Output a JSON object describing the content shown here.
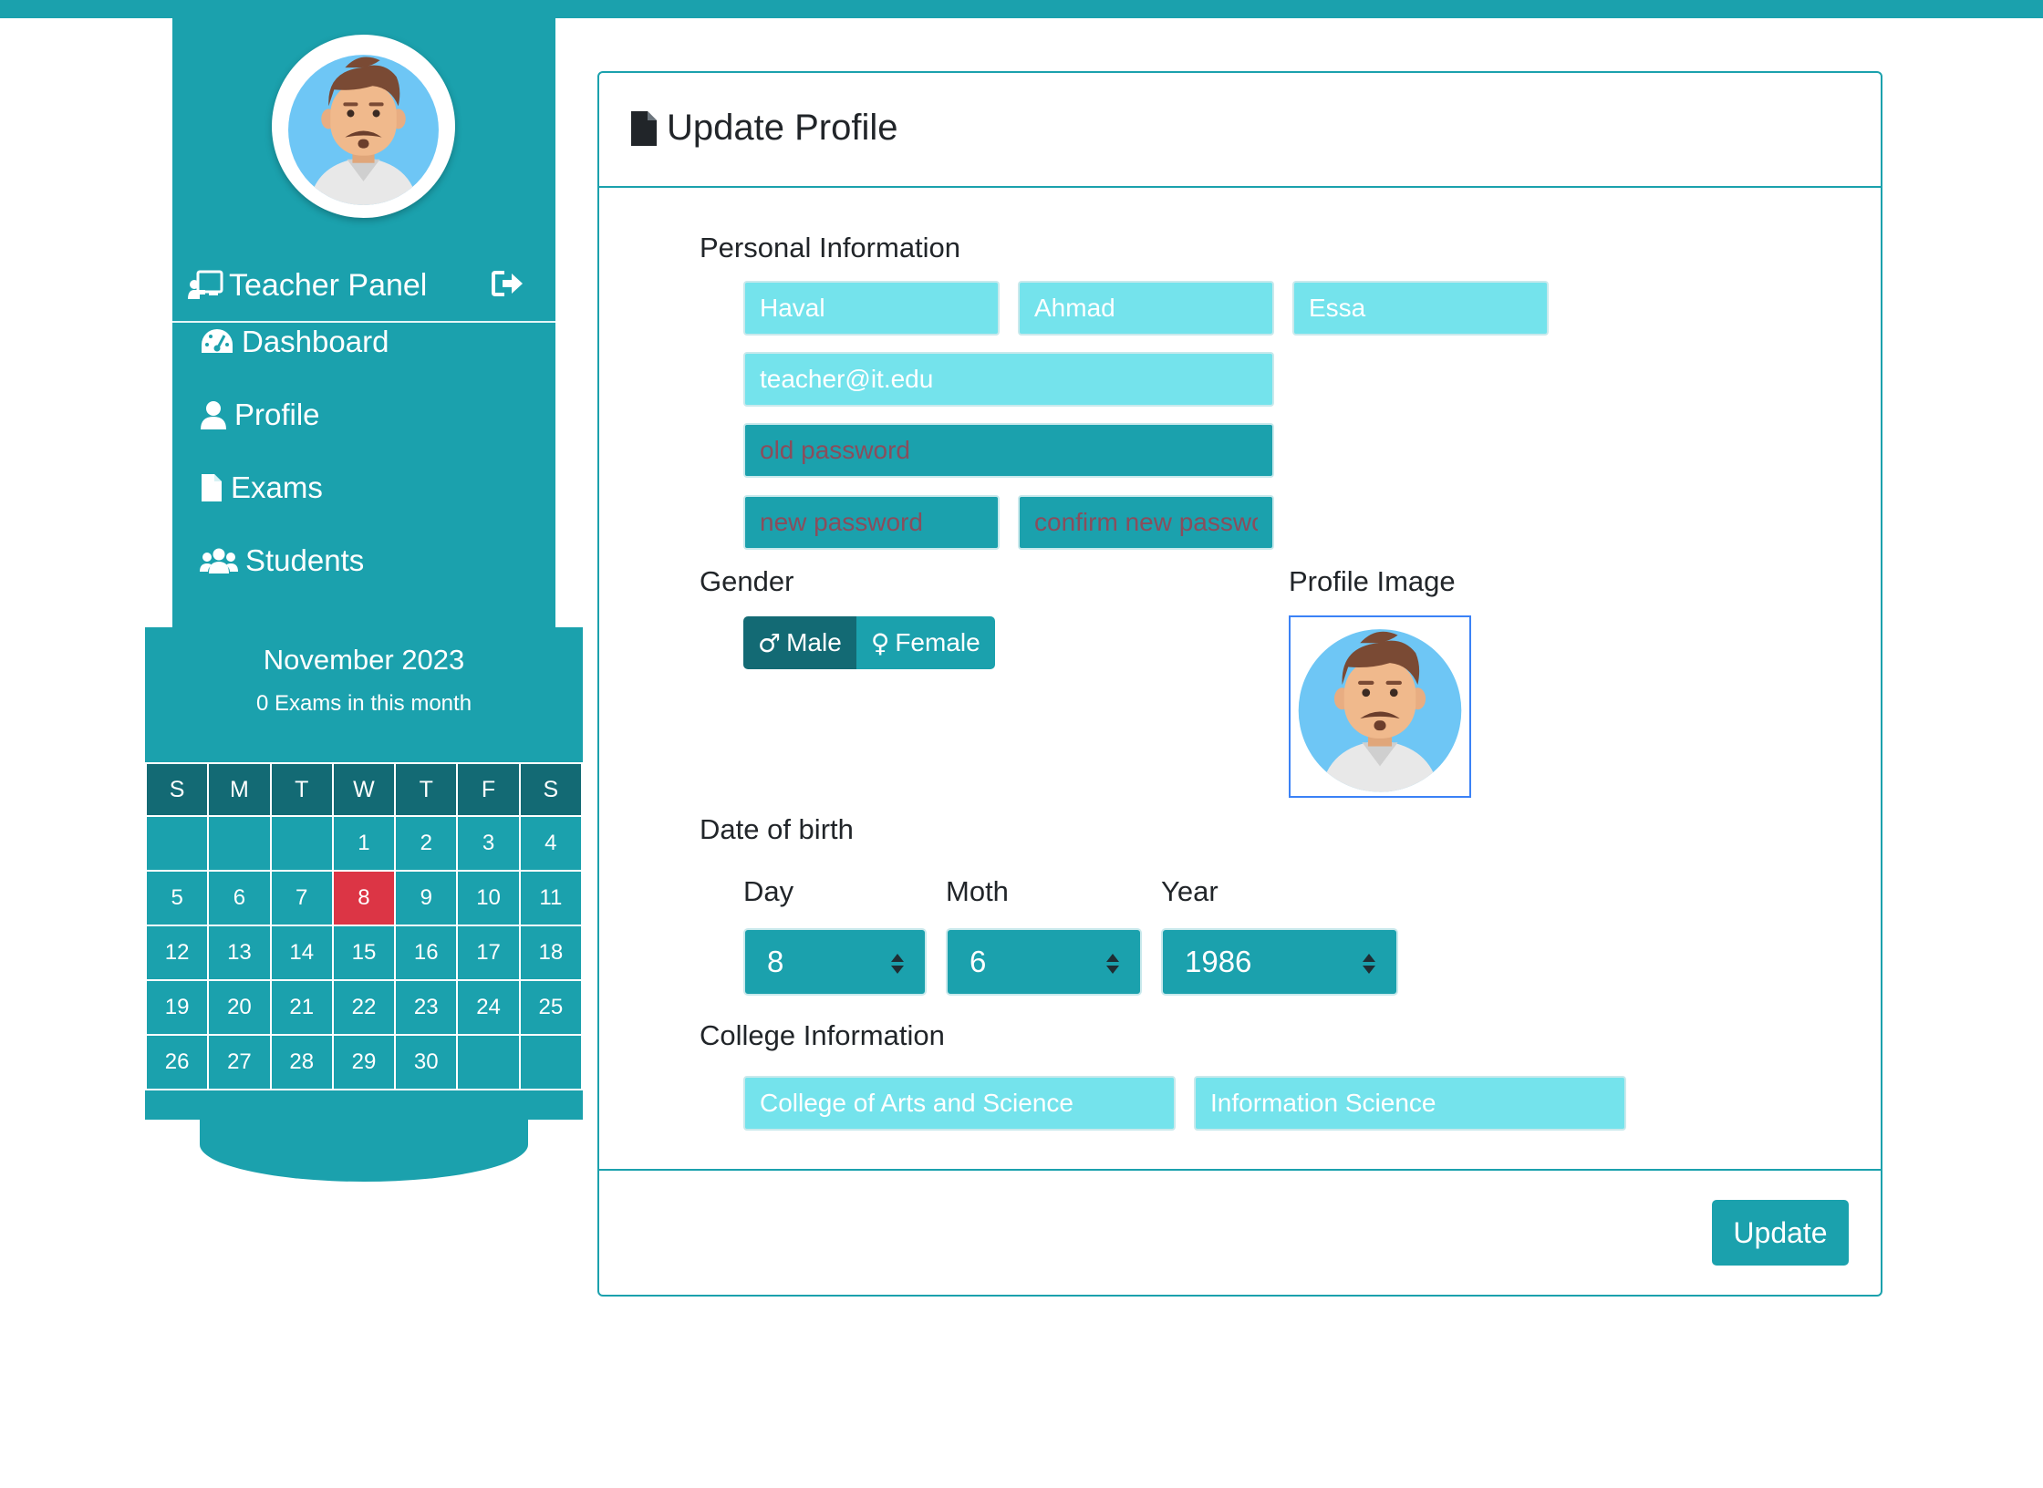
{
  "colors": {
    "primary": "#1ba1ad",
    "primary_dark": "#136a74",
    "field_light": "#74e3ec",
    "today": "#dc3545"
  },
  "sidebar": {
    "panel_title": "Teacher Panel",
    "nav": [
      {
        "label": "Dashboard",
        "icon": "dashboard-icon"
      },
      {
        "label": "Profile",
        "icon": "user-icon"
      },
      {
        "label": "Exams",
        "icon": "file-icon"
      },
      {
        "label": "Students",
        "icon": "users-icon"
      }
    ]
  },
  "calendar": {
    "month": "November 2023",
    "subtitle": "0 Exams in this month",
    "weekdays": [
      "S",
      "M",
      "T",
      "W",
      "T",
      "F",
      "S"
    ],
    "weeks": [
      [
        "",
        "",
        "",
        "1",
        "2",
        "3",
        "4"
      ],
      [
        "5",
        "6",
        "7",
        "8",
        "9",
        "10",
        "11"
      ],
      [
        "12",
        "13",
        "14",
        "15",
        "16",
        "17",
        "18"
      ],
      [
        "19",
        "20",
        "21",
        "22",
        "23",
        "24",
        "25"
      ],
      [
        "26",
        "27",
        "28",
        "29",
        "30",
        "",
        ""
      ]
    ],
    "today": "8"
  },
  "card": {
    "title": "Update Profile",
    "personal_label": "Personal Information",
    "first_name": "Haval",
    "middle_name": "Ahmad",
    "last_name": "Essa",
    "email": "teacher@it.edu",
    "old_password_placeholder": "old password",
    "new_password_placeholder": "new password",
    "confirm_password_placeholder": "confirm new password",
    "gender_label": "Gender",
    "gender_male": "Male",
    "gender_female": "Female",
    "gender_selected": "Male",
    "profile_image_label": "Profile Image",
    "dob_label": "Date of birth",
    "day_label": "Day",
    "month_label": "Moth",
    "year_label": "Year",
    "day_value": "8",
    "month_value": "6",
    "year_value": "1986",
    "college_label": "College Information",
    "college": "College of Arts and Science",
    "department": "Information Science",
    "update_label": "Update"
  }
}
